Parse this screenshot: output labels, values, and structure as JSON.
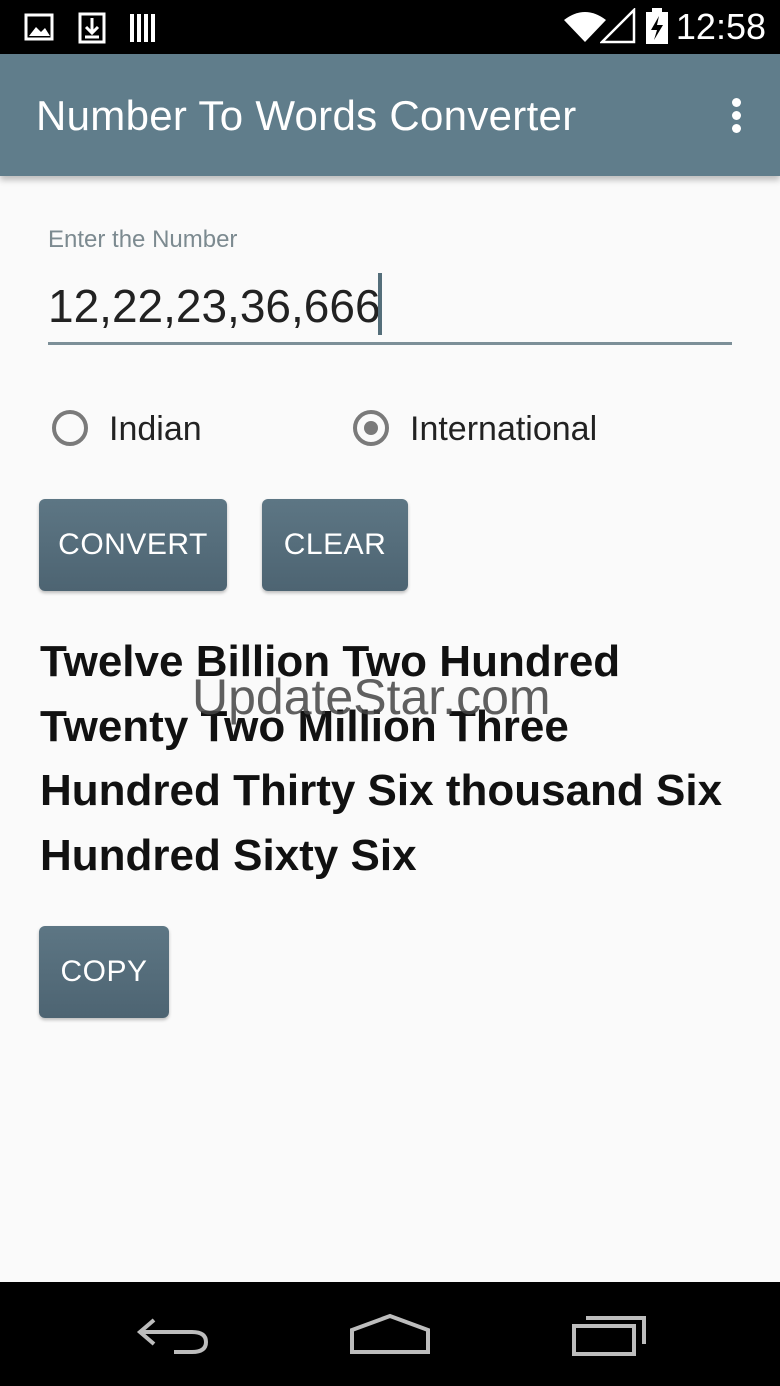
{
  "status_bar": {
    "time": "12:58",
    "icons": [
      "image-icon",
      "download-icon",
      "barcode-icon",
      "wifi-icon",
      "signal-icon",
      "battery-charging-icon"
    ]
  },
  "app_bar": {
    "title": "Number To Words Converter",
    "overflow_icon": "more-vert-icon"
  },
  "form": {
    "label": "Enter the Number",
    "value": "12,22,23,36,666"
  },
  "options": {
    "indian_label": "Indian",
    "international_label": "International",
    "selected": "International"
  },
  "buttons": {
    "convert": "CONVERT",
    "clear": "CLEAR",
    "copy": "COPY"
  },
  "result": {
    "text": "Twelve Billion Two Hundred Twenty Two Million Three Hundred Thirty Six thousand Six Hundred Sixty Six"
  },
  "watermark": "UpdateStar.com",
  "nav_bar": {
    "icons": [
      "back-icon",
      "home-icon",
      "recents-icon"
    ]
  }
}
